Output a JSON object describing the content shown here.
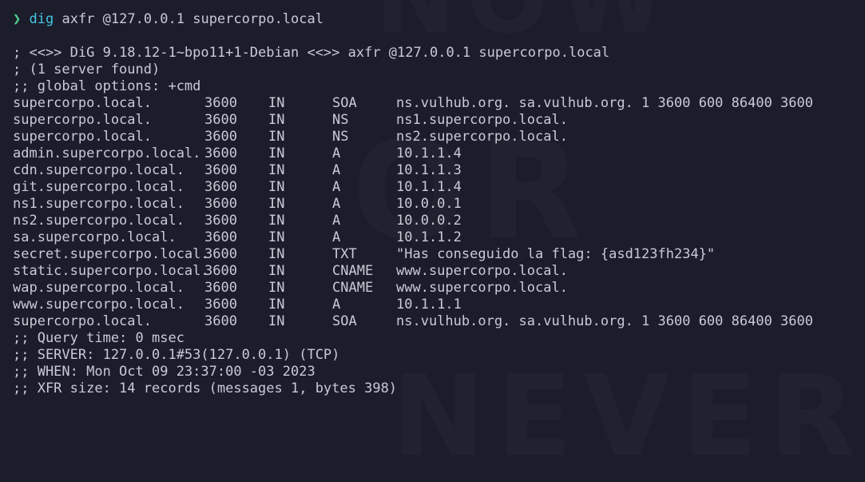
{
  "prompt": {
    "arrow": "❯",
    "command": "dig",
    "args": "axfr @127.0.0.1 supercorpo.local"
  },
  "header": [
    "; <<>> DiG 9.18.12-1~bpo11+1-Debian <<>> axfr @127.0.0.1 supercorpo.local",
    "; (1 server found)",
    ";; global options: +cmd"
  ],
  "records": [
    {
      "name": "supercorpo.local.",
      "ttl": "3600",
      "class": "IN",
      "type": "SOA",
      "data": "ns.vulhub.org. sa.vulhub.org. 1 3600 600 86400 3600"
    },
    {
      "name": "supercorpo.local.",
      "ttl": "3600",
      "class": "IN",
      "type": "NS",
      "data": "ns1.supercorpo.local."
    },
    {
      "name": "supercorpo.local.",
      "ttl": "3600",
      "class": "IN",
      "type": "NS",
      "data": "ns2.supercorpo.local."
    },
    {
      "name": "admin.supercorpo.local.",
      "ttl": "3600",
      "class": "IN",
      "type": "A",
      "data": "10.1.1.4"
    },
    {
      "name": "cdn.supercorpo.local.",
      "ttl": "3600",
      "class": "IN",
      "type": "A",
      "data": "10.1.1.3"
    },
    {
      "name": "git.supercorpo.local.",
      "ttl": "3600",
      "class": "IN",
      "type": "A",
      "data": "10.1.1.4"
    },
    {
      "name": "ns1.supercorpo.local.",
      "ttl": "3600",
      "class": "IN",
      "type": "A",
      "data": "10.0.0.1"
    },
    {
      "name": "ns2.supercorpo.local.",
      "ttl": "3600",
      "class": "IN",
      "type": "A",
      "data": "10.0.0.2"
    },
    {
      "name": "sa.supercorpo.local.",
      "ttl": "3600",
      "class": "IN",
      "type": "A",
      "data": "10.1.1.2"
    },
    {
      "name": "secret.supercorpo.local.",
      "ttl": "3600",
      "class": "IN",
      "type": "TXT",
      "data": "\"Has conseguido la flag: {asd123fh234}\""
    },
    {
      "name": "static.supercorpo.local.",
      "ttl": "3600",
      "class": "IN",
      "type": "CNAME",
      "data": "www.supercorpo.local."
    },
    {
      "name": "wap.supercorpo.local.",
      "ttl": "3600",
      "class": "IN",
      "type": "CNAME",
      "data": "www.supercorpo.local."
    },
    {
      "name": "www.supercorpo.local.",
      "ttl": "3600",
      "class": "IN",
      "type": "A",
      "data": "10.1.1.1"
    },
    {
      "name": "supercorpo.local.",
      "ttl": "3600",
      "class": "IN",
      "type": "SOA",
      "data": "ns.vulhub.org. sa.vulhub.org. 1 3600 600 86400 3600"
    }
  ],
  "footer": [
    ";; Query time: 0 msec",
    ";; SERVER: 127.0.0.1#53(127.0.0.1) (TCP)",
    ";; WHEN: Mon Oct 09 23:37:00 -03 2023",
    ";; XFR size: 14 records (messages 1, bytes 398)"
  ],
  "colors": {
    "background": "#1b1d2b",
    "text": "#c8cbd6",
    "prompt_arrow": "#50d08a",
    "command": "#43c6e3"
  }
}
